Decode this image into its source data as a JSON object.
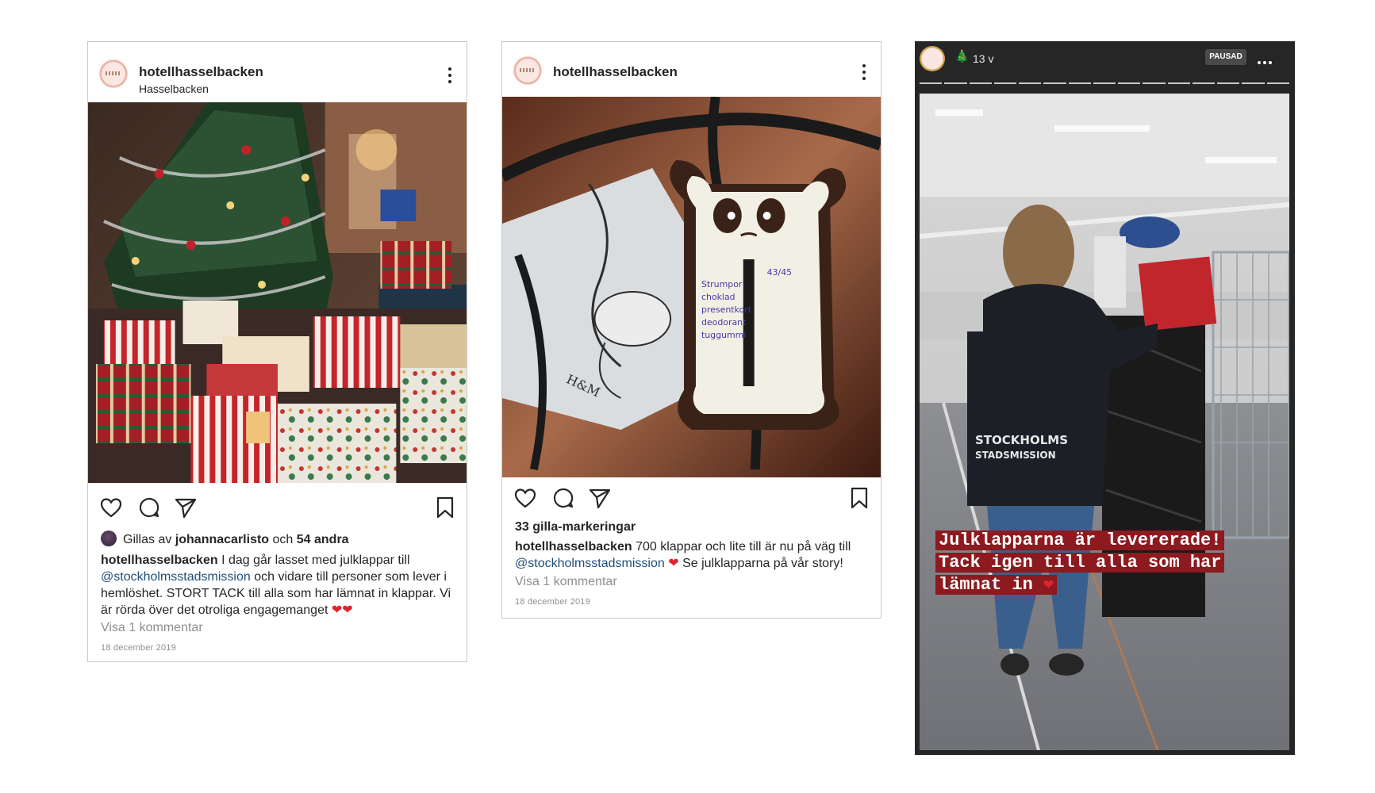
{
  "post1": {
    "username": "hotellhasselbacken",
    "location": "Hasselbacken",
    "likes_prefix": "Gillas av",
    "likes_user": "johannacarlisto",
    "likes_conj": "och",
    "likes_others": "54 andra",
    "caption_user": "hotellhasselbacken",
    "caption_text_1": "I dag går lasset med julklappar till",
    "caption_mention": "@stockholmsstadsmission",
    "caption_text_2": "och vidare till personer som lever i hemlöshet. STORT TACK till alla som har lämnat in klappar. Vi är rörda över det otroliga engagemanget",
    "caption_emoji": "❤❤",
    "view_comments": "Visa 1 kommentar",
    "date": "18 december 2019"
  },
  "post2": {
    "username": "hotellhasselbacken",
    "likes": "33 gilla-markeringar",
    "caption_user": "hotellhasselbacken",
    "caption_text_1": "700 klappar och lite till är nu på väg till",
    "caption_mention": "@stockholmsstadsmission",
    "caption_emoji": "❤",
    "caption_text_2": "Se julklapparna på vår story!",
    "view_comments": "Visa 1 kommentar",
    "date": "18 december 2019",
    "tag_text": [
      "Strumpor",
      "choklad",
      "presentkort",
      "deodorant",
      "tuggummi"
    ],
    "tag_number": "43/45",
    "card_brand": "H&M"
  },
  "story": {
    "time": "13 v",
    "pause_label": "PAUSAD",
    "tree_icon": "🎄",
    "text_lines": [
      "Julklapparna är levererade!",
      "Tack igen till alla som har",
      "lämnat in"
    ],
    "text_emoji": "❤",
    "jacket_print": [
      "STOCKHOLMS",
      "STADSMISSION"
    ],
    "progress_segments": 15
  }
}
